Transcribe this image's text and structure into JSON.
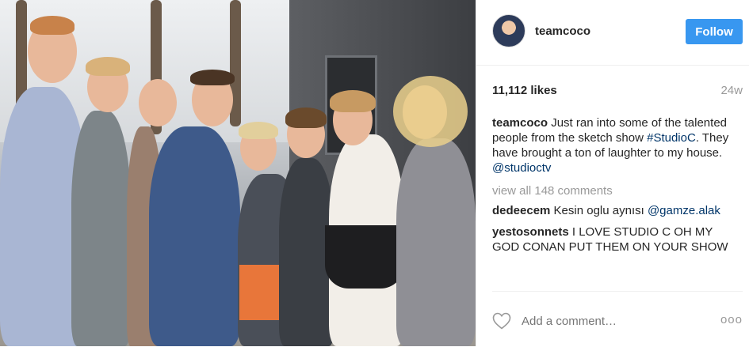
{
  "photo": {
    "alt": "Group photo of people on a sidewalk"
  },
  "header": {
    "username": "teamcoco",
    "follow_label": "Follow",
    "avatar_icon": "avatar-icon"
  },
  "stats": {
    "likes": "11,112 likes",
    "age": "24w"
  },
  "caption": {
    "user": "teamcoco",
    "text_before": "Just ran into some of the talented people from the sketch show ",
    "hashtag": "#StudioC",
    "text_after": ". They have brought a ton of laughter to my house. ",
    "mention": "@studioctv"
  },
  "view_all": "view all 148 comments",
  "comments": [
    {
      "user": "dedeecem",
      "text": "Kesin oglu aynısı ",
      "mention": "@gamze.alak"
    },
    {
      "user": "yestosonnets",
      "text": "I LOVE STUDIO C OH MY GOD CONAN PUT THEM ON YOUR SHOW",
      "mention": ""
    }
  ],
  "footer": {
    "add_comment_placeholder": "Add a comment…",
    "more_label": "ooo",
    "heart_icon": "heart-icon"
  },
  "colors": {
    "accent": "#3897f0",
    "link": "#003569",
    "muted": "#999999"
  }
}
